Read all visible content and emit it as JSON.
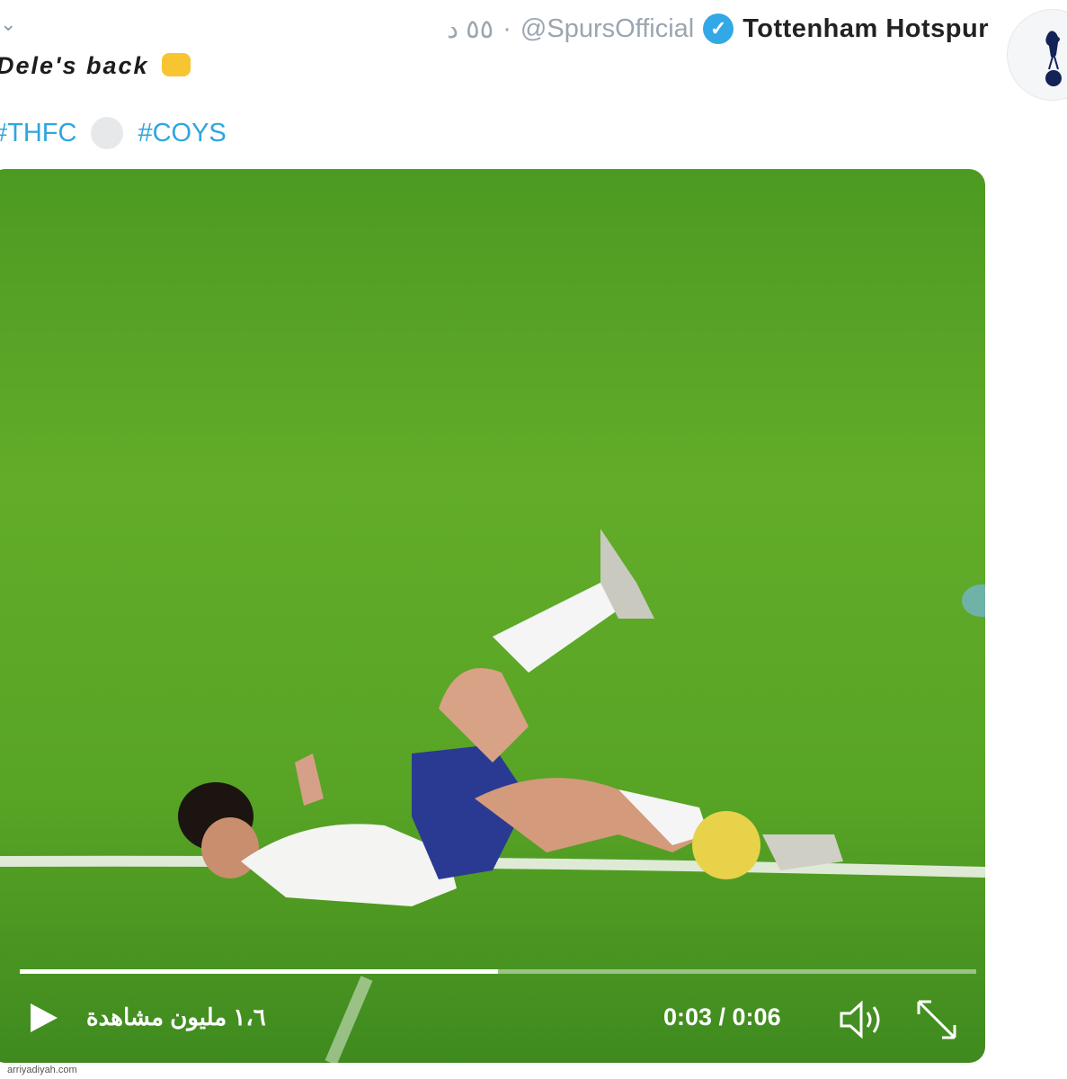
{
  "tweet": {
    "display_name": "Tottenham Hotspur",
    "handle": "@SpursOfficial",
    "timestamp": "٥٥ د",
    "text": "Dele's back",
    "hashtags": [
      "#THFC",
      "#COYS"
    ]
  },
  "video": {
    "current_time": "0:03",
    "duration": "0:06",
    "time_display": "0:03 / 0:06",
    "views": "١،٦ مليون مشاهدة",
    "progress": 0.5
  },
  "icons": {
    "verified": "verified-badge-icon",
    "avatar": "spurs-cockerel-logo",
    "play": "play-icon",
    "volume": "volume-icon",
    "fullscreen": "fullscreen-icon",
    "menu": "chevron-down-icon"
  },
  "colors": {
    "hashtag": "#2fa5e0",
    "verified": "#33a8e6",
    "pitch": "#5aa626"
  },
  "watermark": "arriyadiyah.com"
}
